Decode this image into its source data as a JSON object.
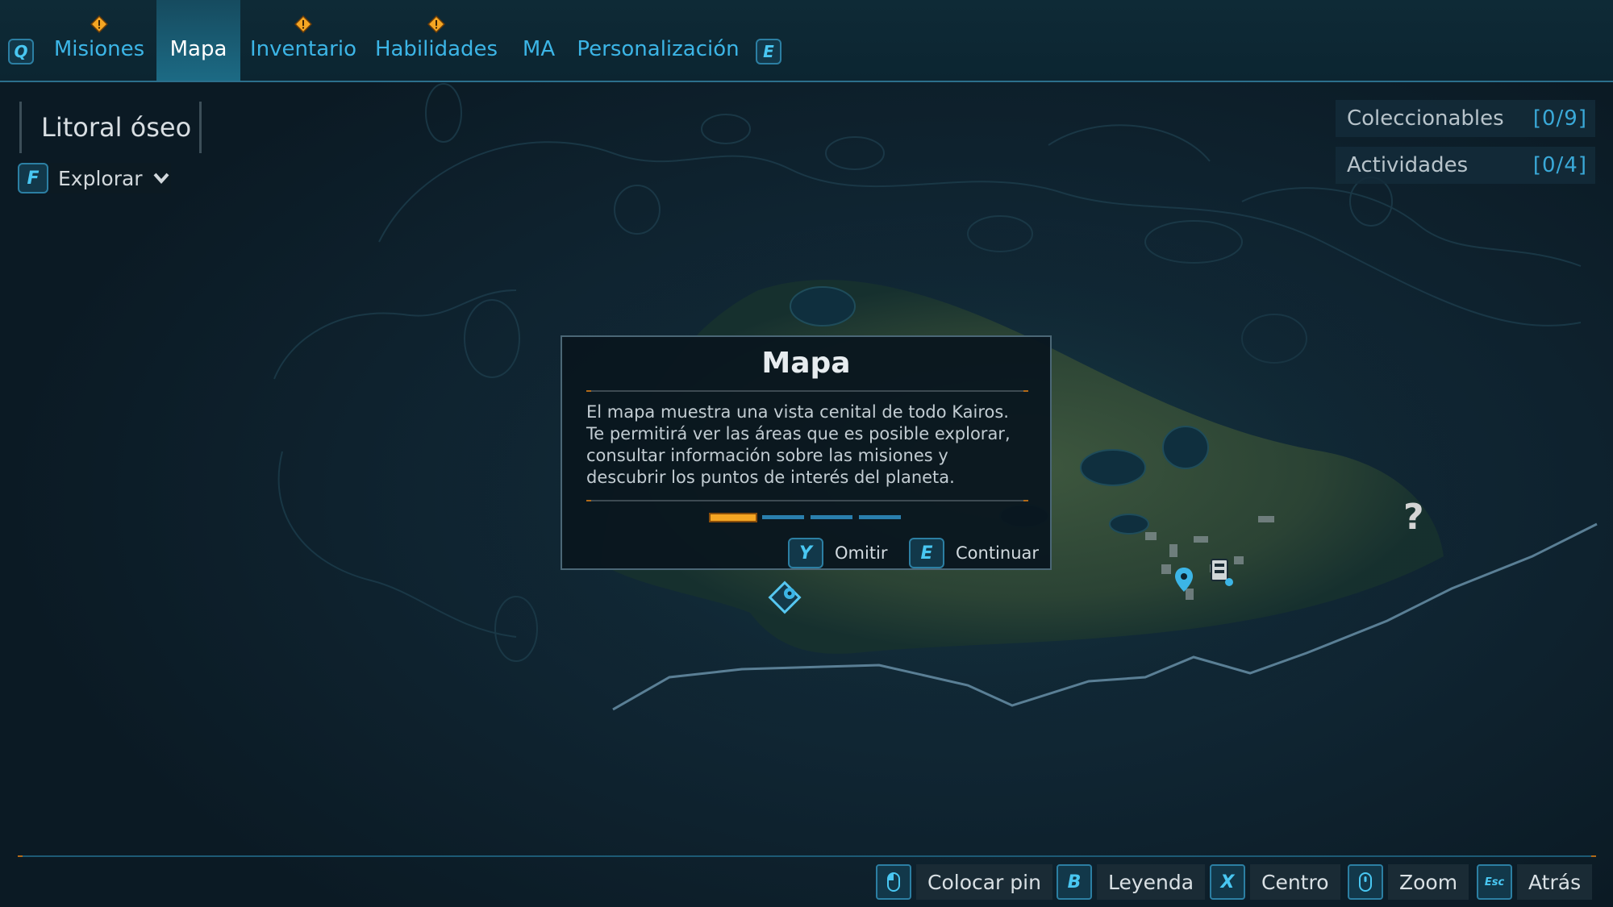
{
  "tabs": {
    "left_key": "Q",
    "right_key": "E",
    "items": [
      {
        "label": "Misiones",
        "alert": true
      },
      {
        "label": "Mapa",
        "alert": false,
        "active": true
      },
      {
        "label": "Inventario",
        "alert": true
      },
      {
        "label": "Habilidades",
        "alert": true
      },
      {
        "label": "MA",
        "alert": false
      },
      {
        "label": "Personalización",
        "alert": false
      }
    ]
  },
  "region": {
    "name": "Litoral óseo",
    "filter_key": "F",
    "filter_label": "Explorar"
  },
  "counters": [
    {
      "label": "Coleccionables",
      "value": "[0/9]"
    },
    {
      "label": "Actividades",
      "value": "[0/4]"
    }
  ],
  "tutorial": {
    "title": "Mapa",
    "body": "El mapa muestra una vista cenital de todo Kairos. Te permitirá ver las áreas que es posible explorar, consultar información sobre las misiones y descubrir los puntos de interés del planeta.",
    "pages_total": 4,
    "page_current": 1,
    "skip": {
      "key": "Y",
      "label": "Omitir"
    },
    "next": {
      "key": "E",
      "label": "Continuar"
    }
  },
  "map_unknown_marker": "?",
  "controls": [
    {
      "key": "mouse-icon",
      "label": "Colocar pin"
    },
    {
      "key": "B",
      "label": "Leyenda"
    },
    {
      "key": "X",
      "label": "Centro"
    },
    {
      "key": "scroll-icon",
      "label": "Zoom"
    },
    {
      "key": "Esc",
      "label": "Atrás"
    }
  ],
  "colors": {
    "accent": "#3cb5e6",
    "alert": "#f5a623",
    "background": "#0c1c27"
  }
}
